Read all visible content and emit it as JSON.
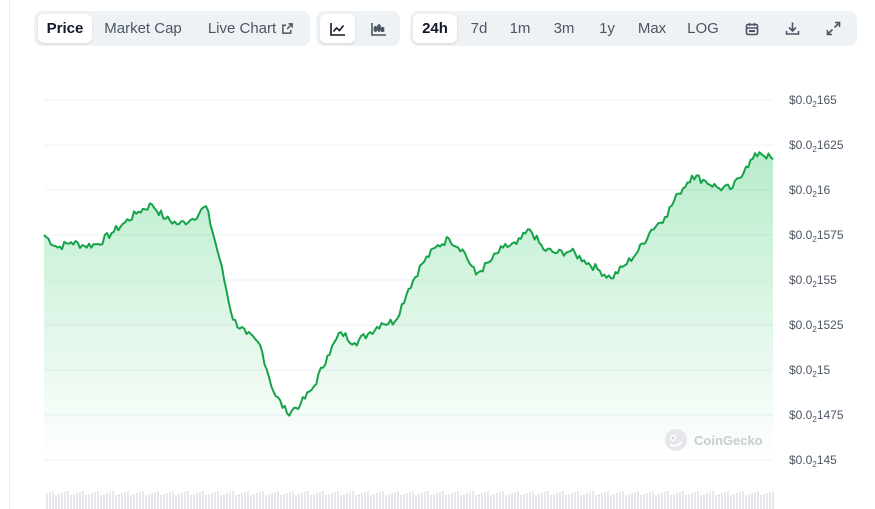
{
  "tabs": {
    "price": "Price",
    "market_cap": "Market Cap",
    "live_chart": "Live Chart"
  },
  "chart_type_buttons": [
    "line-chart-icon",
    "candlestick-chart-icon"
  ],
  "ranges": [
    "24h",
    "7d",
    "1m",
    "3m",
    "1y",
    "Max",
    "LOG"
  ],
  "active_range": "24h",
  "active_tab": "Price",
  "tools": [
    "calendar-icon",
    "download-icon",
    "expand-icon"
  ],
  "watermark": "CoinGecko",
  "colors": {
    "line": "#16a34a",
    "fill": "#22c55e",
    "grid": "#eef0f3",
    "axis_text": "#4b5563",
    "volume": "#e6e8eb"
  },
  "chart_data": {
    "type": "area",
    "title": "",
    "xlabel": "",
    "ylabel": "",
    "y_axis_position": "right",
    "grid": true,
    "ylim": [
      0.01445,
      0.01655
    ],
    "y_ticks": [
      {
        "value": 0.0165,
        "label": "0.0₂165"
      },
      {
        "value": 0.01625,
        "label": "0.0₂1625"
      },
      {
        "value": 0.016,
        "label": "0.0₂16"
      },
      {
        "value": 0.01575,
        "label": "0.0₂1575"
      },
      {
        "value": 0.0155,
        "label": "0.0₂155"
      },
      {
        "value": 0.01525,
        "label": "0.0₂1525"
      },
      {
        "value": 0.015,
        "label": "0.0₂15"
      },
      {
        "value": 0.01475,
        "label": "0.0₂1475"
      },
      {
        "value": 0.0145,
        "label": "0.0₂145"
      }
    ],
    "y_tick_prefix": "$0.0",
    "y_tick_subscript": "2",
    "x_points": 60,
    "series": [
      {
        "values": [
          0.01575,
          0.01568,
          0.01571,
          0.01569,
          0.0157,
          0.01576,
          0.01582,
          0.01588,
          0.01592,
          0.01584,
          0.01581,
          0.01584,
          0.01591,
          0.01562,
          0.01528,
          0.0152,
          0.01514,
          0.01488,
          0.01476,
          0.01481,
          0.01491,
          0.01508,
          0.01521,
          0.01515,
          0.0152,
          0.01526,
          0.01527,
          0.01545,
          0.01559,
          0.01568,
          0.01573,
          0.01567,
          0.01553,
          0.0156,
          0.01568,
          0.0157,
          0.01578,
          0.01567,
          0.01565,
          0.01566,
          0.01561,
          0.01556,
          0.01551,
          0.01558,
          0.01566,
          0.01578,
          0.01585,
          0.01598,
          0.01608,
          0.01605,
          0.01601,
          0.01601,
          0.01613,
          0.01621,
          0.01617
        ],
        "x_index": [
          0,
          1,
          2,
          3,
          4,
          5,
          6,
          7,
          8,
          9,
          10,
          11,
          12,
          13,
          14,
          15,
          16,
          17,
          18,
          19,
          20,
          21,
          22,
          23,
          24,
          25,
          26,
          27,
          28,
          29,
          30,
          31,
          32,
          33,
          34,
          35,
          36,
          37,
          38,
          39,
          40,
          41,
          42,
          43,
          44,
          45,
          46,
          47,
          48,
          49,
          50,
          51,
          52,
          53,
          54
        ]
      }
    ],
    "volume_bars": true
  }
}
